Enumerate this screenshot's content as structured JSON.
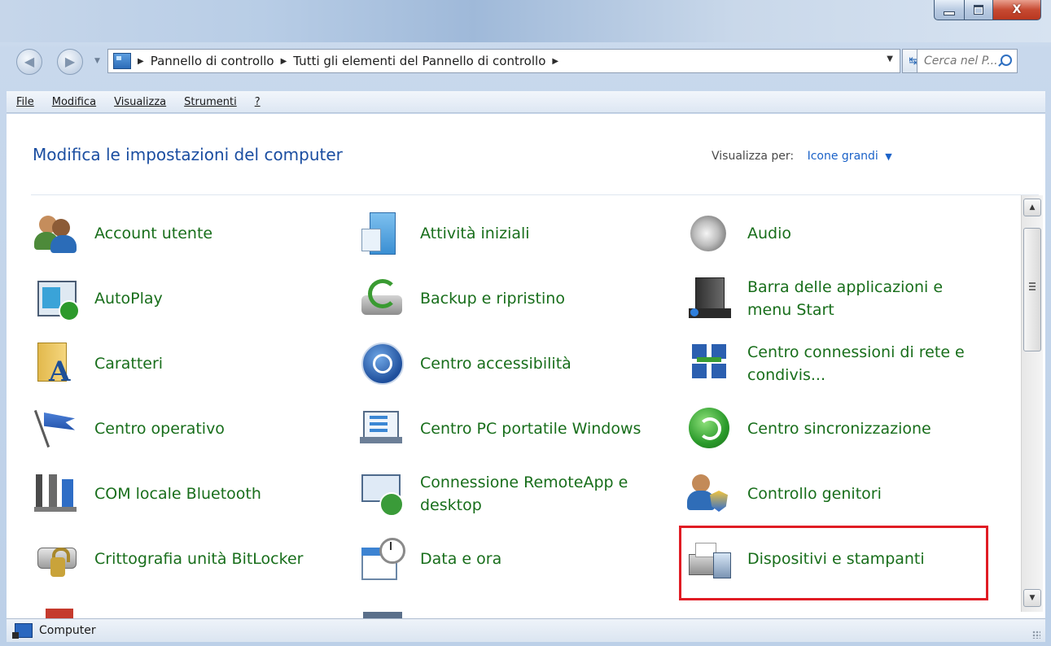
{
  "window": {
    "buttons": {
      "minimize": "—",
      "maximize": "□",
      "close": "X"
    }
  },
  "address": {
    "crumbs": [
      "Pannello di controllo",
      "Tutti gli elementi del Pannello di controllo"
    ],
    "search_placeholder": "Cerca nel P..."
  },
  "menu": [
    "File",
    "Modifica",
    "Visualizza",
    "Strumenti",
    "?"
  ],
  "header": {
    "title": "Modifica le impostazioni del computer",
    "view_by_label": "Visualizza per:",
    "view_by_value": "Icone grandi"
  },
  "items": [
    {
      "label": "Account utente",
      "icon": "user-accounts-icon"
    },
    {
      "label": "Attività iniziali",
      "icon": "getting-started-icon"
    },
    {
      "label": "Audio",
      "icon": "speaker-icon"
    },
    {
      "label": "AutoPlay",
      "icon": "autoplay-icon"
    },
    {
      "label": "Backup e ripristino",
      "icon": "backup-icon"
    },
    {
      "label": "Barra delle applicazioni e menu Start",
      "icon": "taskbar-icon"
    },
    {
      "label": "Caratteri",
      "icon": "fonts-folder-icon"
    },
    {
      "label": "Centro accessibilità",
      "icon": "accessibility-icon"
    },
    {
      "label": "Centro connessioni di rete e condivis...",
      "icon": "network-icon"
    },
    {
      "label": "Centro operativo",
      "icon": "action-center-flag-icon"
    },
    {
      "label": "Centro PC portatile Windows",
      "icon": "mobility-center-icon"
    },
    {
      "label": "Centro sincronizzazione",
      "icon": "sync-icon"
    },
    {
      "label": "COM locale Bluetooth",
      "icon": "bluetooth-com-icon"
    },
    {
      "label": "Connessione RemoteApp e desktop",
      "icon": "remoteapp-icon"
    },
    {
      "label": "Controllo genitori",
      "icon": "parental-controls-icon"
    },
    {
      "label": "Crittografia unità BitLocker",
      "icon": "bitlocker-icon"
    },
    {
      "label": "Data e ora",
      "icon": "date-time-icon"
    },
    {
      "label": "Dispositivi e stampanti",
      "icon": "printer-icon"
    }
  ],
  "status": {
    "text": "Computer"
  },
  "colors": {
    "link_green": "#186e1b",
    "heading_blue": "#1b4ea1",
    "highlight_red": "#e01c24"
  }
}
